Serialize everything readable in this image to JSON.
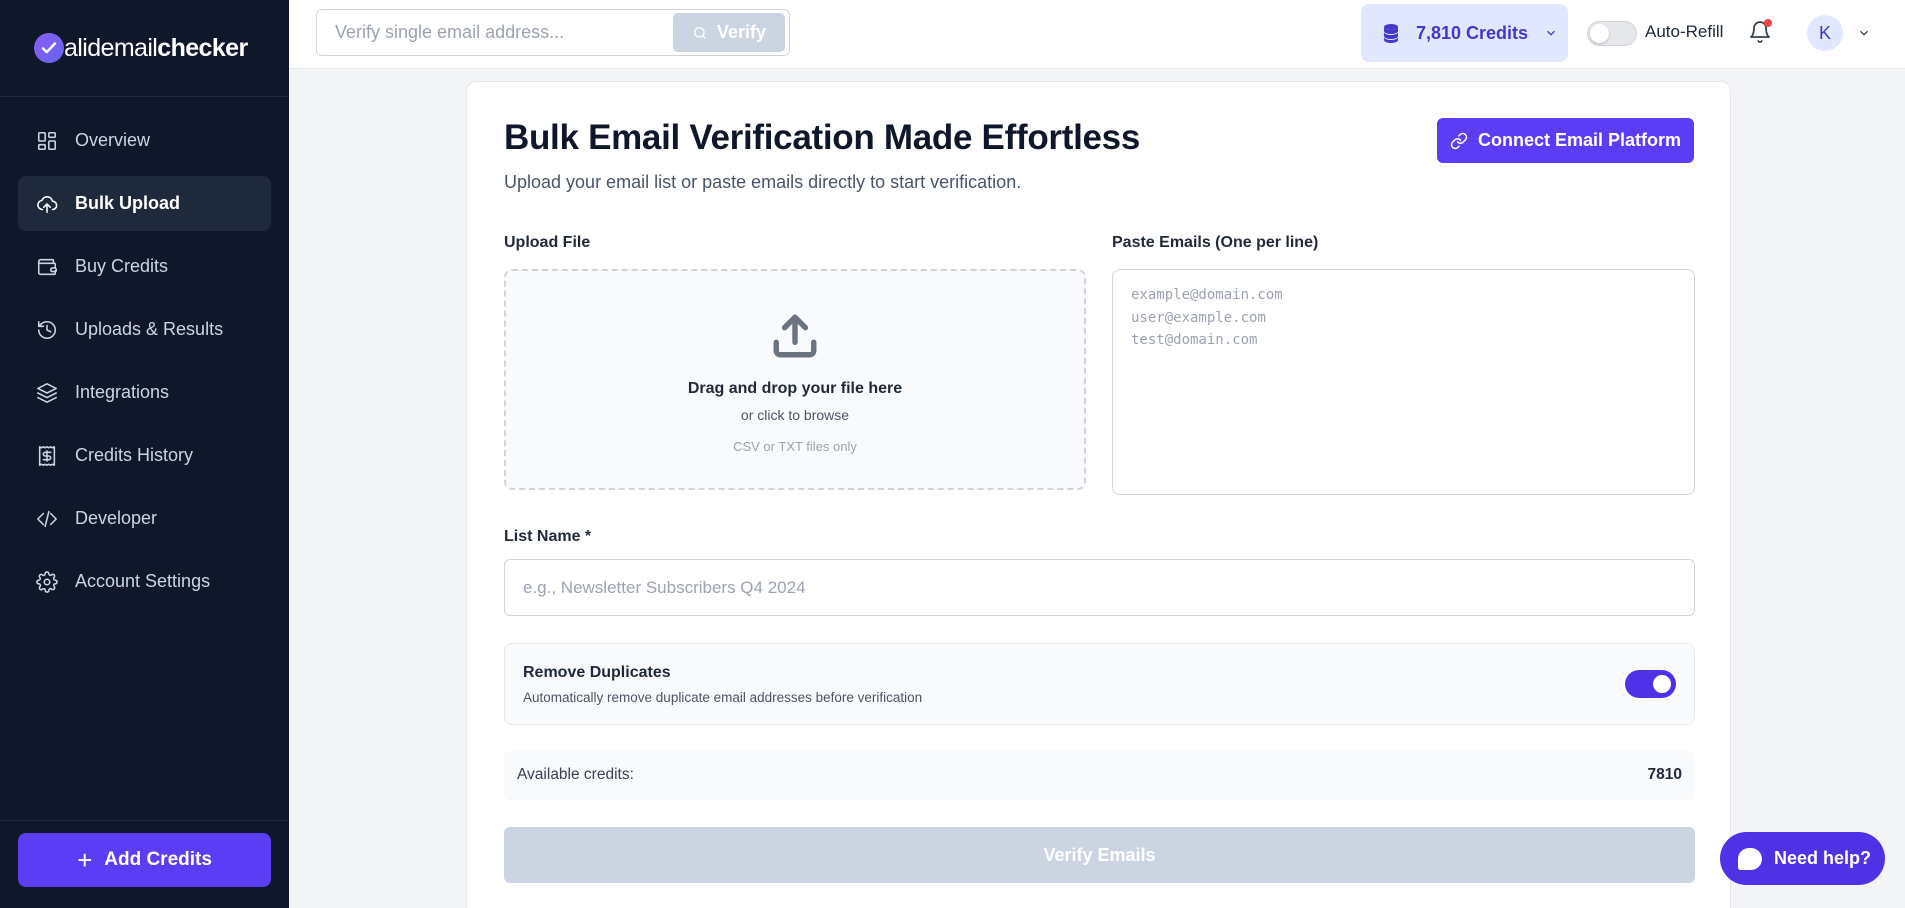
{
  "brand": {
    "logo_light": "alidemail",
    "logo_bold": "checker"
  },
  "sidebar": {
    "items": [
      {
        "label": "Overview",
        "icon": "grid-icon"
      },
      {
        "label": "Bulk Upload",
        "icon": "cloud-upload-icon",
        "active": true
      },
      {
        "label": "Buy Credits",
        "icon": "wallet-icon"
      },
      {
        "label": "Uploads & Results",
        "icon": "history-icon"
      },
      {
        "label": "Integrations",
        "icon": "layers-icon"
      },
      {
        "label": "Credits History",
        "icon": "receipt-dollar-icon"
      },
      {
        "label": "Developer",
        "icon": "code-icon"
      },
      {
        "label": "Account Settings",
        "icon": "gear-icon"
      }
    ],
    "add_credits_label": "Add Credits"
  },
  "topbar": {
    "search_placeholder": "Verify single email address...",
    "verify_label": "Verify",
    "credits_label": "7,810 Credits",
    "auto_refill_label": "Auto-Refill",
    "auto_refill_on": false,
    "avatar_initial": "K"
  },
  "main": {
    "title": "Bulk Email Verification Made Effortless",
    "subtitle": "Upload your email list or paste emails directly to start verification.",
    "connect_label": "Connect Email Platform",
    "upload_label": "Upload File",
    "dropzone_main": "Drag and drop your file here",
    "dropzone_sub": "or click to browse",
    "dropzone_hint": "CSV or TXT files only",
    "paste_label": "Paste Emails (One per line)",
    "paste_placeholder_lines": [
      "example@domain.com",
      "user@example.com",
      "test@domain.com"
    ],
    "list_name_label": "List Name *",
    "list_name_placeholder": "e.g., Newsletter Subscribers Q4 2024",
    "remove_dup_title": "Remove Duplicates",
    "remove_dup_desc": "Automatically remove duplicate email addresses before verification",
    "remove_dup_on": true,
    "available_label": "Available credits:",
    "available_value": "7810",
    "verify_emails_label": "Verify Emails"
  },
  "help_label": "Need help?",
  "colors": {
    "accent": "#5b3df5",
    "sidebar_bg": "#0f172a",
    "disabled": "#cbd5e1"
  }
}
